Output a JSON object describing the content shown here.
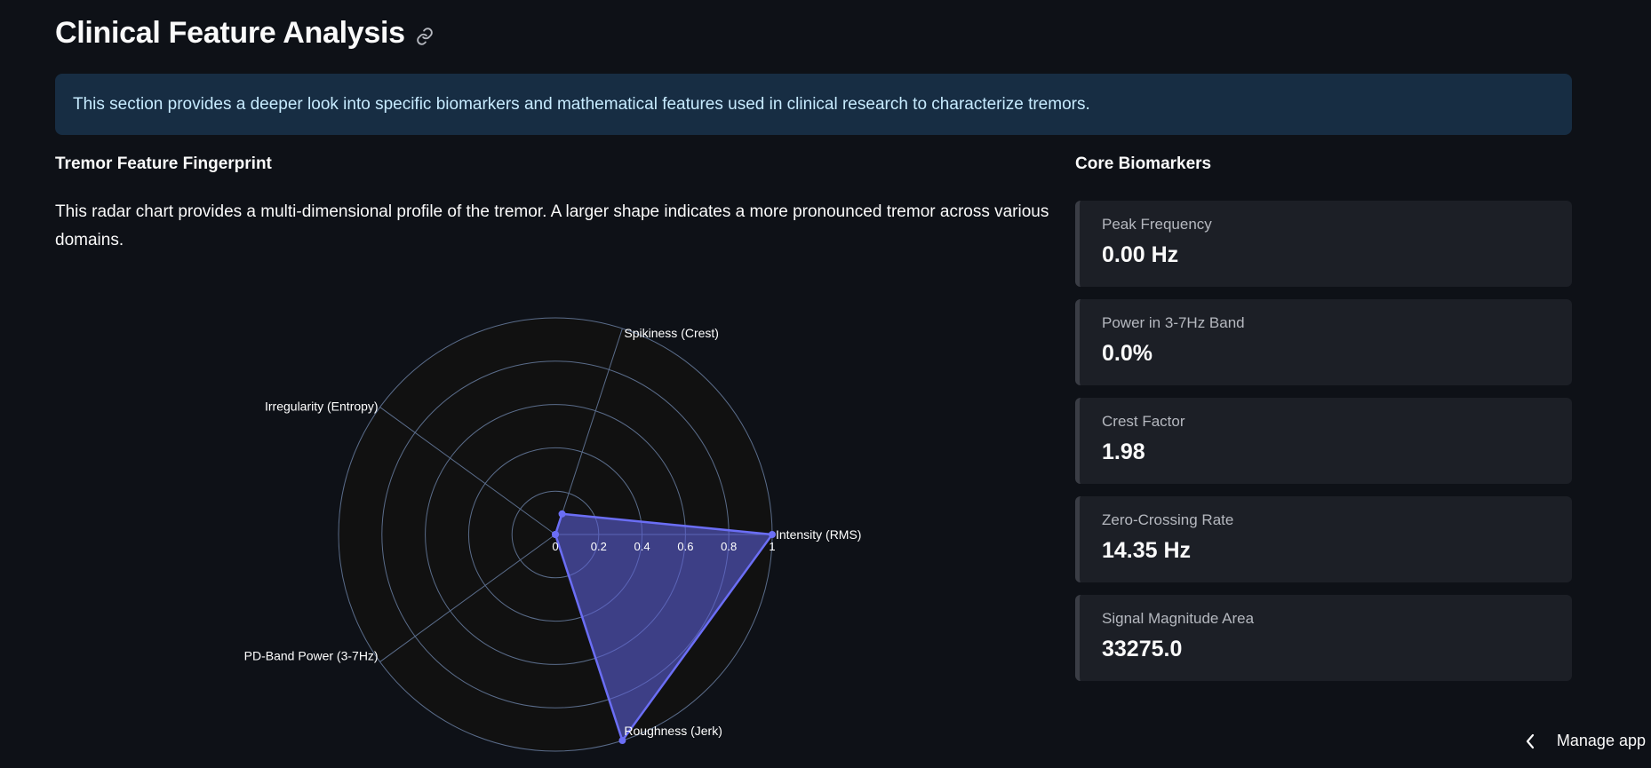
{
  "page": {
    "title": "Clinical Feature Analysis",
    "info_text": "This section provides a deeper look into specific biomarkers and mathematical features used in clinical research to characterize tremors."
  },
  "left": {
    "heading": "Tremor Feature Fingerprint",
    "description": "This radar chart provides a multi-dimensional profile of the tremor. A larger shape indicates a more pronounced tremor across various domains."
  },
  "chart_data": {
    "type": "radar",
    "axes": [
      "Intensity (RMS)",
      "Roughness (Jerk)",
      "PD-Band Power (3-7Hz)",
      "Irregularity (Entropy)",
      "Spikiness (Crest)"
    ],
    "values": [
      1.0,
      1.0,
      0.0,
      0.0,
      0.1
    ],
    "radial_ticks": [
      "0",
      "0.2",
      "0.4",
      "0.6",
      "0.8",
      "1"
    ],
    "radial_range": [
      0,
      1
    ],
    "colors": {
      "fill": "#5c5fd6",
      "line": "#6b6ef5",
      "grid": "#5a6c8a",
      "background": "#111111"
    }
  },
  "right": {
    "heading": "Core Biomarkers",
    "metrics": [
      {
        "label": "Peak Frequency",
        "value": "0.00 Hz"
      },
      {
        "label": "Power in 3-7Hz Band",
        "value": "0.0%"
      },
      {
        "label": "Crest Factor",
        "value": "1.98"
      },
      {
        "label": "Zero-Crossing Rate",
        "value": "14.35 Hz"
      },
      {
        "label": "Signal Magnitude Area",
        "value": "33275.0"
      }
    ]
  },
  "footer": {
    "manage_app_label": "Manage app",
    "icons": {
      "title_link": "link-icon",
      "manage": "chevron-left-icon"
    }
  }
}
